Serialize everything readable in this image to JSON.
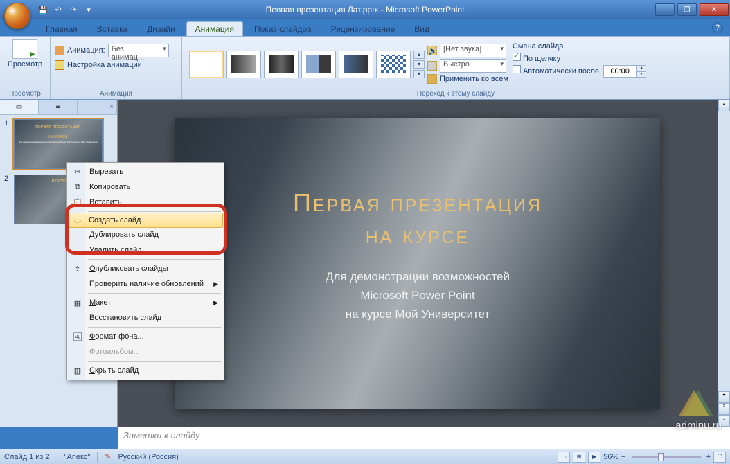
{
  "window": {
    "title": "Певпая презентация Лат.pptx - Microsoft PowerPoint"
  },
  "tabs": [
    "Главная",
    "Вставка",
    "Дизайн",
    "Анимация",
    "Показ слайдов",
    "Рецензирование",
    "Вид"
  ],
  "active_tab": 3,
  "ribbon": {
    "preview": {
      "label": "Просмотр",
      "group": "Просмотр"
    },
    "animation": {
      "label": "Анимация:",
      "combo_value": "Без анимац...",
      "custom": "Настройка анимации",
      "group": "Анимация"
    },
    "transition": {
      "sound_label_icon": "🔊",
      "sound_combo": "[Нет звука]",
      "speed_combo": "Быстро",
      "apply_all": "Применить ко всем",
      "group": "Переход к этому слайду"
    },
    "advance": {
      "header": "Смена слайда",
      "on_click": "По щелчку",
      "auto_after": "Автоматически после:",
      "time": "00:00"
    }
  },
  "thumbs": {
    "slide1": {
      "title": "ПЕРВАЯ ПРЕЗЕНТАЦИЯ",
      "title2": "НА КУРСЕ",
      "sub": "Для демонстрации возможностей Microsoft Power Point на курсе Мой Университет"
    },
    "slide2": {
      "title": "ВТОРАЯ"
    }
  },
  "context_menu": [
    {
      "icon": "✂",
      "label": "Вырезать",
      "ul": "В"
    },
    {
      "icon": "⧉",
      "label": "Копировать",
      "ul": "К"
    },
    {
      "icon": "📋",
      "label": "Вставить",
      "ul": "В",
      "pos": 0
    },
    {
      "sep": true
    },
    {
      "icon": "▭",
      "label": "Создать слайд",
      "ul": "д",
      "hover": true
    },
    {
      "icon": "",
      "label": "Дублировать слайд",
      "ul": "Д"
    },
    {
      "icon": "",
      "label": "Удалить слайд",
      "ul": "У"
    },
    {
      "sep": true
    },
    {
      "icon": "⇪",
      "label": "Опубликовать слайды",
      "ul": "О"
    },
    {
      "icon": "",
      "label": "Проверить наличие обновлений",
      "ul": "П",
      "arrow": true
    },
    {
      "sep": true
    },
    {
      "icon": "▦",
      "label": "Макет",
      "ul": "М",
      "arrow": true
    },
    {
      "icon": "",
      "label": "Восстановить слайд",
      "ul": "о"
    },
    {
      "sep": true
    },
    {
      "icon": "🖼",
      "label": "Формат фона...",
      "ul": "Ф"
    },
    {
      "icon": "",
      "label": "Фотоальбом...",
      "disabled": true
    },
    {
      "sep": true
    },
    {
      "icon": "▥",
      "label": "Скрыть слайд",
      "ul": "С"
    }
  ],
  "slide": {
    "title_line1": "Первая презентация",
    "title_line2": "на курсе",
    "sub1": "Для демонстрации возможностей",
    "sub2": "Microsoft Power Point",
    "sub3": "на курсе Мой Университет"
  },
  "notes_placeholder": "Заметки к слайду",
  "status": {
    "slide_count": "Слайд 1 из 2",
    "theme": "\"Апекс\"",
    "language": "Русский (Россия)",
    "zoom": "56%"
  },
  "watermark": "adminu.ru"
}
